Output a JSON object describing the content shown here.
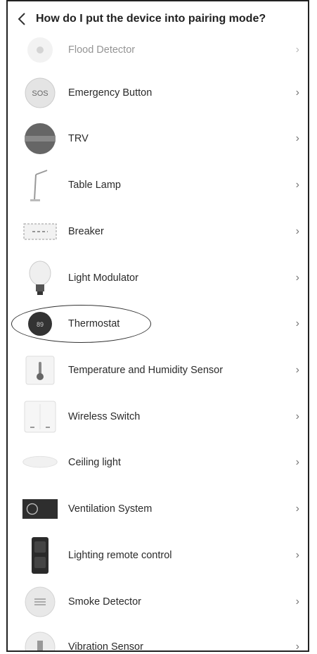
{
  "header": {
    "back_icon": "chevron-left-icon",
    "title": "How do I put the device into pairing mode?"
  },
  "items": [
    {
      "label": "Flood Detector",
      "icon": "flood-detector-icon"
    },
    {
      "label": "Emergency Button",
      "icon": "sos-button-icon",
      "icon_text": "SOS"
    },
    {
      "label": "TRV",
      "icon": "trv-icon"
    },
    {
      "label": "Table Lamp",
      "icon": "table-lamp-icon"
    },
    {
      "label": "Breaker",
      "icon": "breaker-icon"
    },
    {
      "label": "Light Modulator",
      "icon": "light-bulb-icon"
    },
    {
      "label": "Thermostat",
      "icon": "thermostat-icon",
      "icon_text": "89",
      "highlighted": true
    },
    {
      "label": "Temperature and Humidity Sensor",
      "icon": "thermometer-icon"
    },
    {
      "label": "Wireless Switch",
      "icon": "wireless-switch-icon"
    },
    {
      "label": "Ceiling light",
      "icon": "ceiling-light-icon"
    },
    {
      "label": "Ventilation System",
      "icon": "ventilation-icon"
    },
    {
      "label": "Lighting remote control",
      "icon": "remote-control-icon"
    },
    {
      "label": "Smoke Detector",
      "icon": "smoke-detector-icon"
    },
    {
      "label": "Vibration Sensor",
      "icon": "vibration-sensor-icon"
    }
  ],
  "chevron_glyph": "›"
}
